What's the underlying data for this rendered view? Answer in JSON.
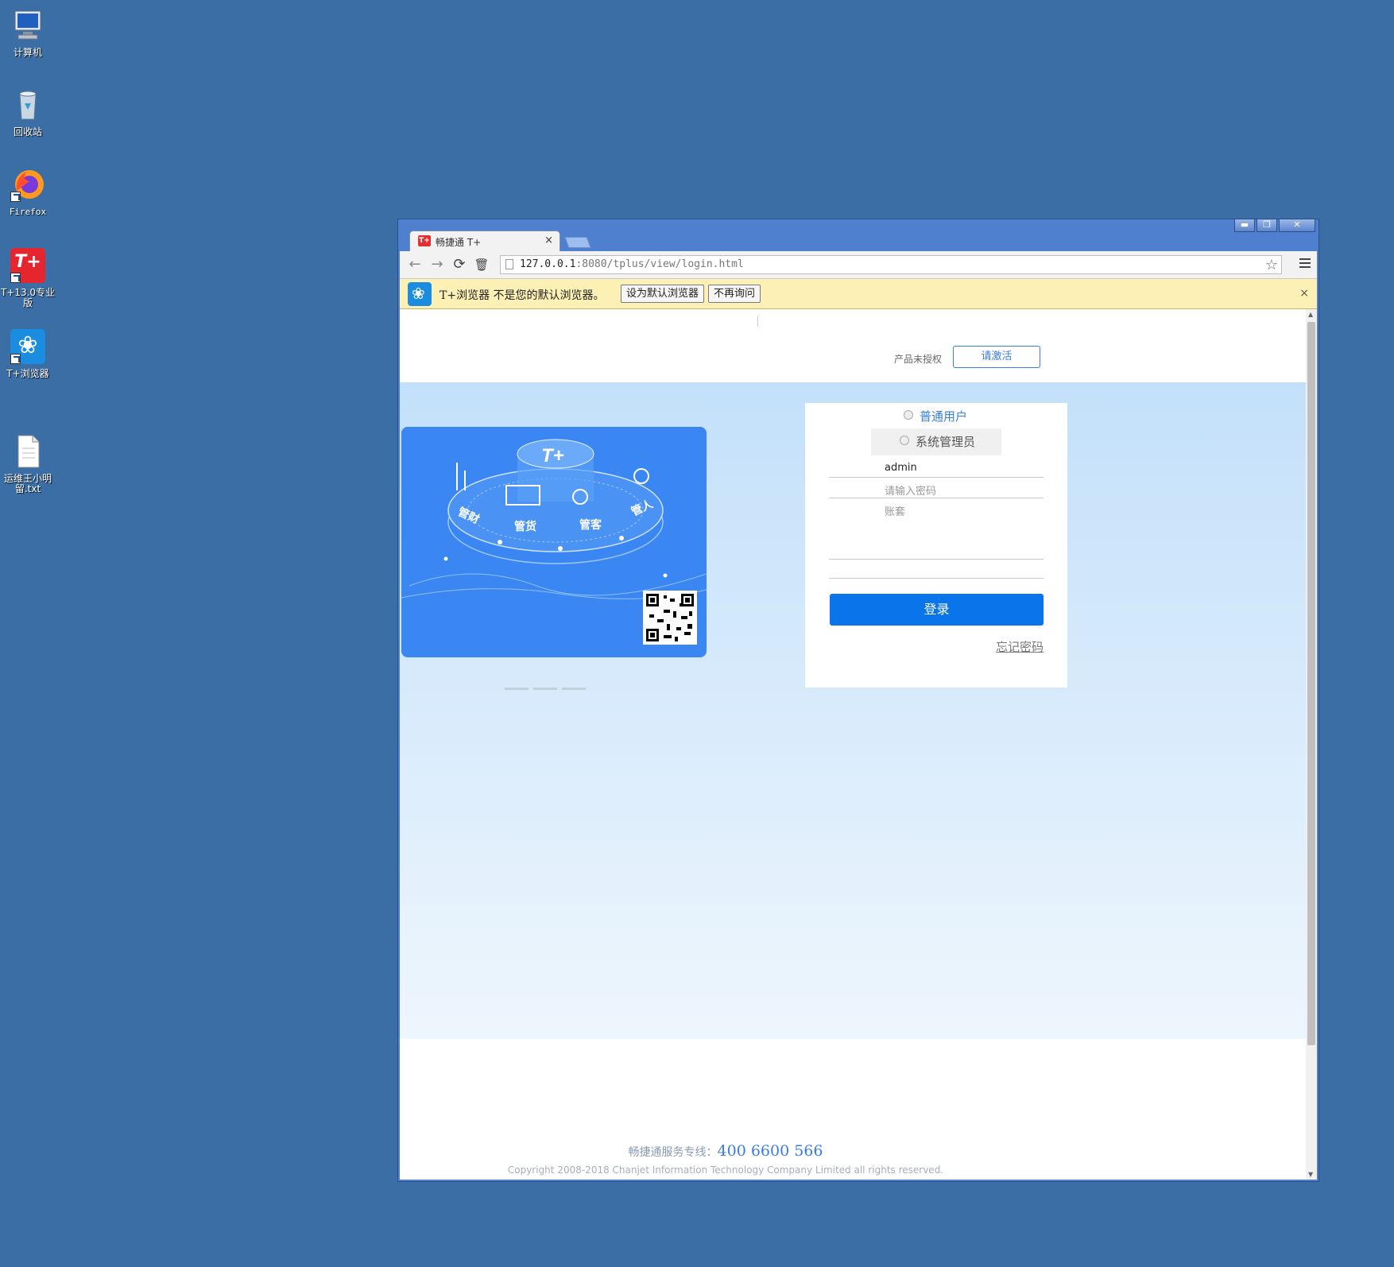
{
  "desktop": {
    "icons": [
      {
        "label": "计算机"
      },
      {
        "label": "回收站"
      },
      {
        "label": "Firefox"
      },
      {
        "label": "T+13.0专业版"
      },
      {
        "label": "T+浏览器"
      },
      {
        "label": "运维王小明\n留.txt"
      }
    ]
  },
  "window": {
    "controls": {
      "minimize": "▬",
      "maximize": "❐",
      "close": "✕"
    },
    "tab": {
      "favicon": "T+",
      "title": "畅捷通 T+",
      "close": "×"
    }
  },
  "toolbar": {
    "back": "←",
    "forward": "→",
    "reload": "⟳",
    "trash": "🗑",
    "url_host": "127.0.0.1",
    "url_path": ":8080/tplus/view/login.html",
    "star": "☆"
  },
  "infobar": {
    "message": "T+浏览器 不是您的默认浏览器。",
    "set_default_label": "设为默认浏览器",
    "dont_ask_label": "不再询问",
    "close": "×"
  },
  "page": {
    "license_text": "产品未授权",
    "activate_label": "请激活",
    "banner": {
      "labels": [
        "管财",
        "管货",
        "管客",
        "管人"
      ],
      "logo": "T+"
    },
    "login": {
      "radio_normal": "普通用户",
      "radio_admin": "系统管理员",
      "username_value": "admin",
      "password_placeholder": "请输入密码",
      "account_placeholder": "账套",
      "login_label": "登录",
      "forgot_label": "忘记密码"
    },
    "footer": {
      "hotline_label": "畅捷通服务专线：",
      "hotline_number": "400  6600  566",
      "copyright": "Copyright 2008-2018 Chanjet Information Technology Company Limited all rights reserved."
    }
  },
  "colors": {
    "desktop": "#3b6ea5",
    "accent": "#0a74ea",
    "banner": "#3a87f3",
    "infobar": "#fdf0b4"
  }
}
